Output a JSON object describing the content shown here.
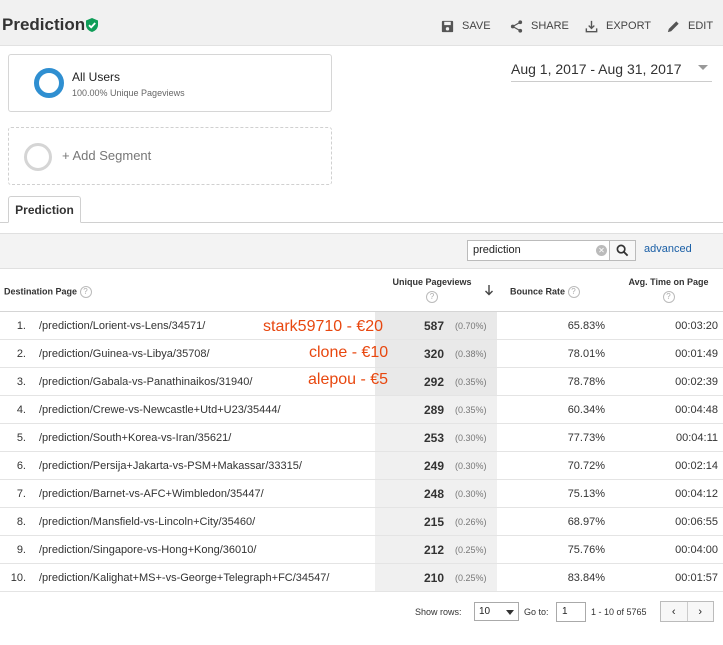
{
  "header": {
    "title": "Prediction",
    "actions": {
      "save": "SAVE",
      "share": "SHARE",
      "export": "EXPORT",
      "edit": "EDIT"
    }
  },
  "segment": {
    "name": "All Users",
    "subtitle": "100.00% Unique Pageviews",
    "add_label": "+ Add Segment"
  },
  "date_range": "Aug 1, 2017 - Aug 31, 2017",
  "tab": "Prediction",
  "search": {
    "value": "prediction",
    "advanced": "advanced"
  },
  "columns": {
    "destination": "Destination Page",
    "unique_pageviews": "Unique Pageviews",
    "bounce_rate": "Bounce Rate",
    "avg_time": "Avg. Time on Page"
  },
  "rows": [
    {
      "idx": "1.",
      "page": "/prediction/Lorient-vs-Lens/34571/",
      "pv": "587",
      "pct": "(0.70%)",
      "bounce": "65.83%",
      "time": "00:03:20"
    },
    {
      "idx": "2.",
      "page": "/prediction/Guinea-vs-Libya/35708/",
      "pv": "320",
      "pct": "(0.38%)",
      "bounce": "78.01%",
      "time": "00:01:49"
    },
    {
      "idx": "3.",
      "page": "/prediction/Gabala-vs-Panathinaikos/31940/",
      "pv": "292",
      "pct": "(0.35%)",
      "bounce": "78.78%",
      "time": "00:02:39"
    },
    {
      "idx": "4.",
      "page": "/prediction/Crewe-vs-Newcastle+Utd+U23/35444/",
      "pv": "289",
      "pct": "(0.35%)",
      "bounce": "60.34%",
      "time": "00:04:48"
    },
    {
      "idx": "5.",
      "page": "/prediction/South+Korea-vs-Iran/35621/",
      "pv": "253",
      "pct": "(0.30%)",
      "bounce": "77.73%",
      "time": "00:04:11"
    },
    {
      "idx": "6.",
      "page": "/prediction/Persija+Jakarta-vs-PSM+Makassar/33315/",
      "pv": "249",
      "pct": "(0.30%)",
      "bounce": "70.72%",
      "time": "00:02:14"
    },
    {
      "idx": "7.",
      "page": "/prediction/Barnet-vs-AFC+Wimbledon/35447/",
      "pv": "248",
      "pct": "(0.30%)",
      "bounce": "75.13%",
      "time": "00:04:12"
    },
    {
      "idx": "8.",
      "page": "/prediction/Mansfield-vs-Lincoln+City/35460/",
      "pv": "215",
      "pct": "(0.26%)",
      "bounce": "68.97%",
      "time": "00:06:55"
    },
    {
      "idx": "9.",
      "page": "/prediction/Singapore-vs-Hong+Kong/36010/",
      "pv": "212",
      "pct": "(0.25%)",
      "bounce": "75.76%",
      "time": "00:04:00"
    },
    {
      "idx": "10.",
      "page": "/prediction/Kalighat+MS+-vs-George+Telegraph+FC/34547/",
      "pv": "210",
      "pct": "(0.25%)",
      "bounce": "83.84%",
      "time": "00:01:57"
    }
  ],
  "annotations": [
    "stark59710 - €20",
    "clone - €10",
    "alepou - €5"
  ],
  "footer": {
    "show_rows_label": "Show rows:",
    "show_rows_value": "10",
    "goto_label": "Go to:",
    "goto_value": "1",
    "range": "1 - 10 of 5765"
  },
  "colors": {
    "accent": "#1a5fa6",
    "verified": "#0f9d58",
    "annotation": "#e8470f",
    "segment_ring": "#2f8fd1"
  }
}
